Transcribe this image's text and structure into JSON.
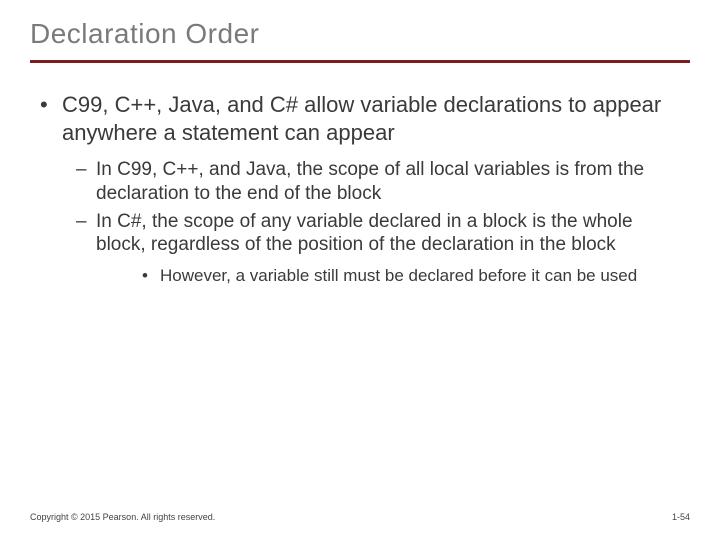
{
  "title": "Declaration Order",
  "main_bullet": "C99, C++, Java, and C# allow variable declarations to appear anywhere a statement can appear",
  "sub_bullets": [
    "In C99, C++, and Java, the scope of all local variables is from the declaration to the end of the block",
    "In C#, the scope of any variable declared in a block is the whole block, regardless of the position of the declaration in the block"
  ],
  "sub_sub_bullet": "However, a variable still must be declared before it can be used",
  "footer": {
    "copyright": "Copyright © 2015 Pearson. All rights reserved.",
    "page": "1-54"
  }
}
